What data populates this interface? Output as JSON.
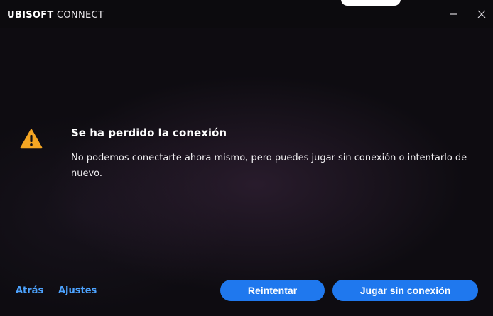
{
  "window": {
    "brand_bold": "UBISOFT",
    "brand_light": " CONNECT"
  },
  "message": {
    "title": "Se ha perdido la conexión",
    "body": "No podemos conectarte ahora mismo, pero puedes jugar sin conexión o intentarlo de nuevo.",
    "icon": "warning-triangle-icon"
  },
  "footer": {
    "back_label": "Atrás",
    "settings_label": "Ajustes",
    "retry_label": "Reintentar",
    "offline_label": "Jugar sin conexión"
  },
  "colors": {
    "accent": "#1f78ee",
    "link": "#4da3ff",
    "warning": "#f5a623",
    "background": "#0e0c11"
  }
}
